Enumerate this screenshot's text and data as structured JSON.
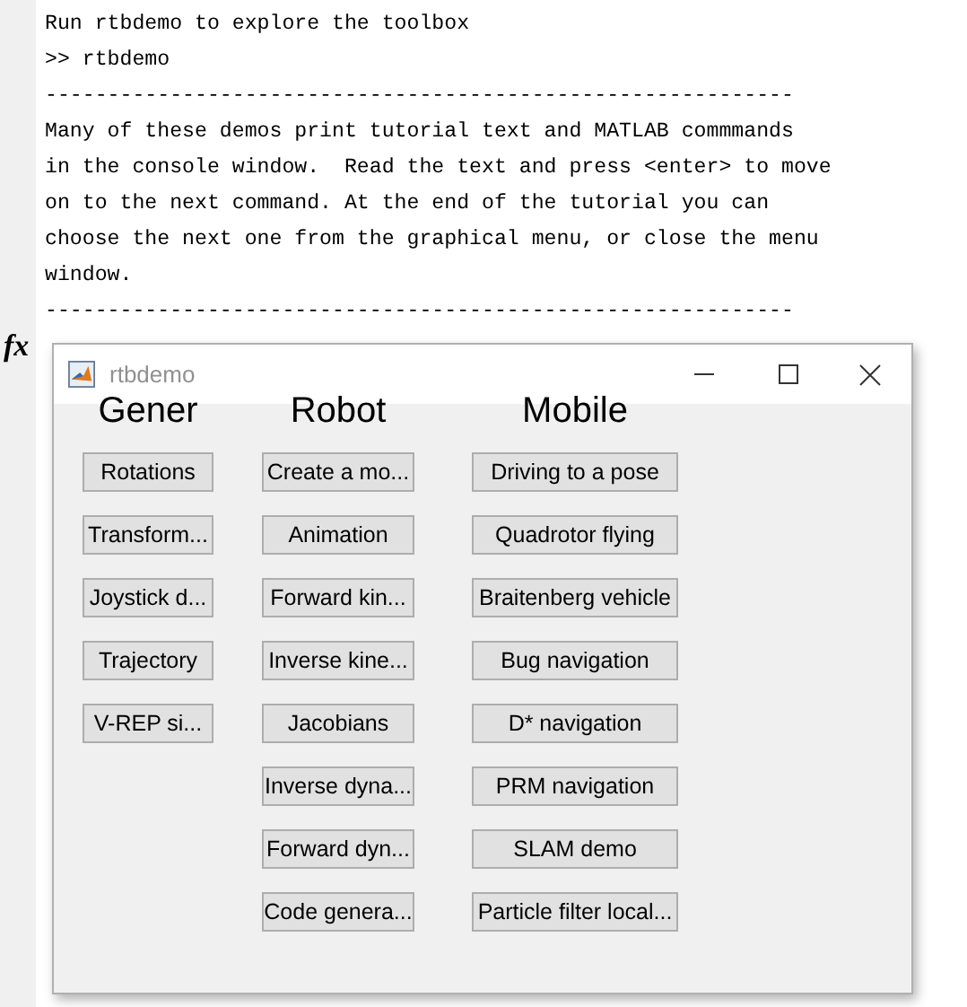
{
  "console": {
    "lines": [
      "Run rtbdemo to explore the toolbox",
      ">> rtbdemo",
      "------------------------------------------------------------",
      "Many of these demos print tutorial text and MATLAB commmands",
      "in the console window.  Read the text and press <enter> to move",
      "on to the next command. At the end of the tutorial you can",
      "choose the next one from the graphical menu, or close the menu",
      "window.",
      "------------------------------------------------------------"
    ],
    "prompt_icon": "fx"
  },
  "window": {
    "title": "rtbdemo",
    "columns": [
      {
        "heading": "Gener",
        "buttons": [
          "Rotations",
          "Transform...",
          "Joystick d...",
          "Trajectory",
          "V-REP si..."
        ]
      },
      {
        "heading": "Robot",
        "buttons": [
          "Create a mo...",
          "Animation",
          "Forward kin...",
          "Inverse kine...",
          "Jacobians",
          "Inverse dyna...",
          "Forward dyn...",
          "Code genera..."
        ]
      },
      {
        "heading": "Mobile",
        "buttons": [
          "Driving to a pose",
          "Quadrotor flying",
          "Braitenberg vehicle",
          "Bug navigation",
          "D* navigation",
          "PRM navigation",
          "SLAM demo",
          "Particle filter local..."
        ]
      }
    ]
  }
}
